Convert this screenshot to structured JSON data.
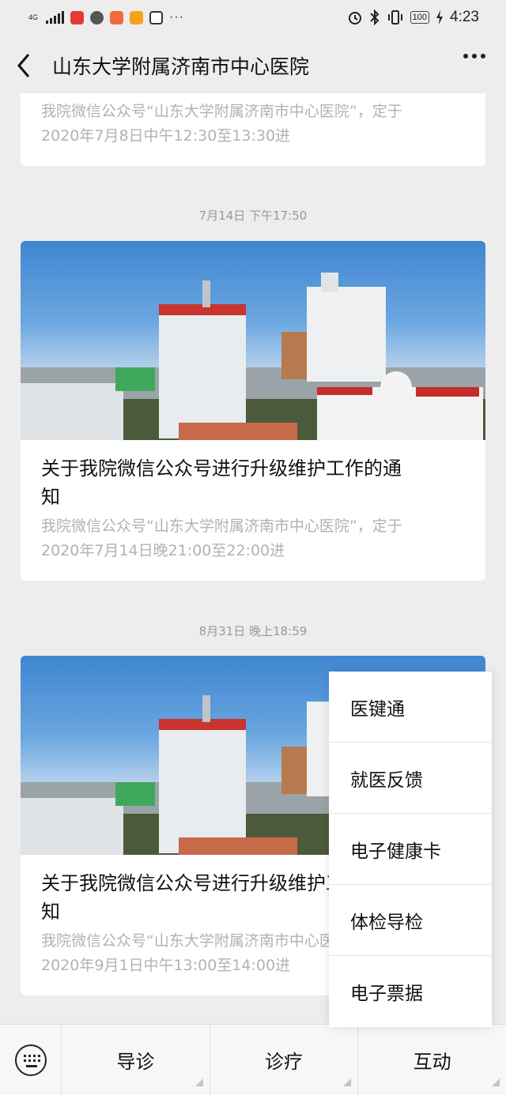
{
  "status_bar": {
    "network": "4G",
    "more": "···",
    "battery": "100",
    "time": "4:23"
  },
  "nav": {
    "title": "山东大学附属济南市中心医院"
  },
  "feed": {
    "card1": {
      "digest_line1": "我院微信公众号“山东大学附属济南市中心医院”，定于",
      "digest_line2": "2020年7月8日中午12:30至13:30进"
    },
    "time2": "7月14日 下午17:50",
    "card2": {
      "title_line1": "关于我院微信公众号进行升级维护工作的通",
      "title_line2": "知",
      "digest_line1": "我院微信公众号“山东大学附属济南市中心医院”，定于",
      "digest_line2": "2020年7月14日晚21:00至22:00进"
    },
    "time3": "8月31日 晚上18:59",
    "card3": {
      "title_line1": "关于我院微信公众号进行升级维护工作的通",
      "title_line2": "知",
      "digest_line1": "我院微信公众号“山东大学附属济南市中心医院”，定于",
      "digest_line2": "2020年9月1日中午13:00至14:00进"
    }
  },
  "popup_menu": {
    "items": [
      "医键通",
      "就医反馈",
      "电子健康卡",
      "体检导检",
      "电子票据"
    ]
  },
  "bottom_menu": {
    "items": [
      "导诊",
      "诊疗",
      "互动"
    ]
  },
  "colors": {
    "background": "#ededed",
    "card": "#ffffff",
    "digest_text": "#b2b2b2",
    "time_label": "#9a9a9a"
  },
  "icons": [
    "back-arrow-icon",
    "more-dots-icon",
    "keyboard-icon",
    "alarm-icon",
    "bluetooth-icon",
    "vibrate-icon",
    "charging-icon"
  ]
}
